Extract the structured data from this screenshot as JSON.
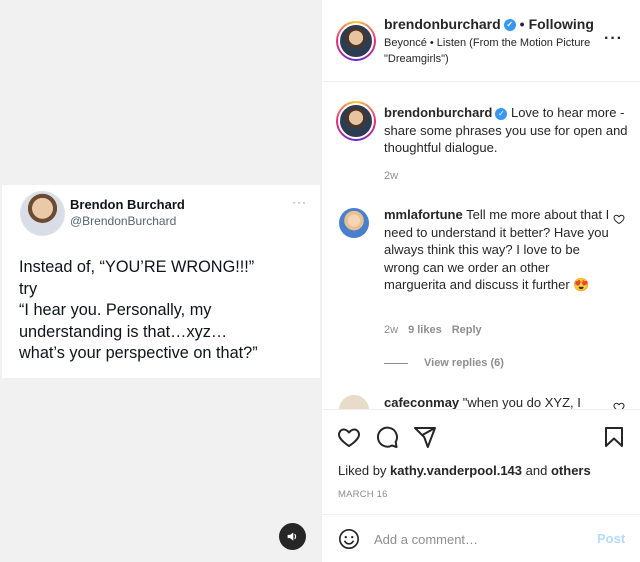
{
  "tweet": {
    "name": "Brendon Burchard",
    "handle": "@BrendonBurchard",
    "more": "···",
    "lines": [
      "Instead of, “YOU’RE WRONG!!!”",
      "try",
      "“I hear you. Personally, my",
      "understanding is that…xyz…",
      "what’s your perspective on that?”"
    ]
  },
  "header": {
    "username": "brendonburchard",
    "dot": "•",
    "follow_label": "Following",
    "music": "Beyoncé • Listen (From the Motion Picture \"Dreamgirls\")",
    "more": "···"
  },
  "caption": {
    "username": "brendonburchard",
    "text": "Love to hear more - share some phrases you use for open and thoughtful dialogue.",
    "time": "2w"
  },
  "comment": {
    "username": "mmlafortune",
    "text": "Tell me more about that I need to understand it better? Have you always think this way? I love to be wrong can we order an other marguerita and discuss it further 😍",
    "time": "2w",
    "likes": "9 likes",
    "reply_label": "Reply",
    "view_replies": "View replies (6)"
  },
  "comment2": {
    "username": "cafeconmay",
    "text": "\"when you do XYZ, I"
  },
  "actions": {
    "liked_prefix": "Liked by",
    "liked_user": "kathy.vanderpool.143",
    "liked_and": "and",
    "liked_others": "others",
    "date": "MARCH 16"
  },
  "add_comment": {
    "placeholder": "Add a comment…",
    "post_label": "Post"
  },
  "colors": {
    "verified": "#3897f0",
    "post_disabled": "#b3dbff",
    "secondary_text": "#8e8e8e"
  },
  "icons": [
    "sound-icon",
    "like-icon",
    "comment-icon",
    "share-icon",
    "save-icon",
    "emoji-icon",
    "verified-icon",
    "more-icon"
  ]
}
